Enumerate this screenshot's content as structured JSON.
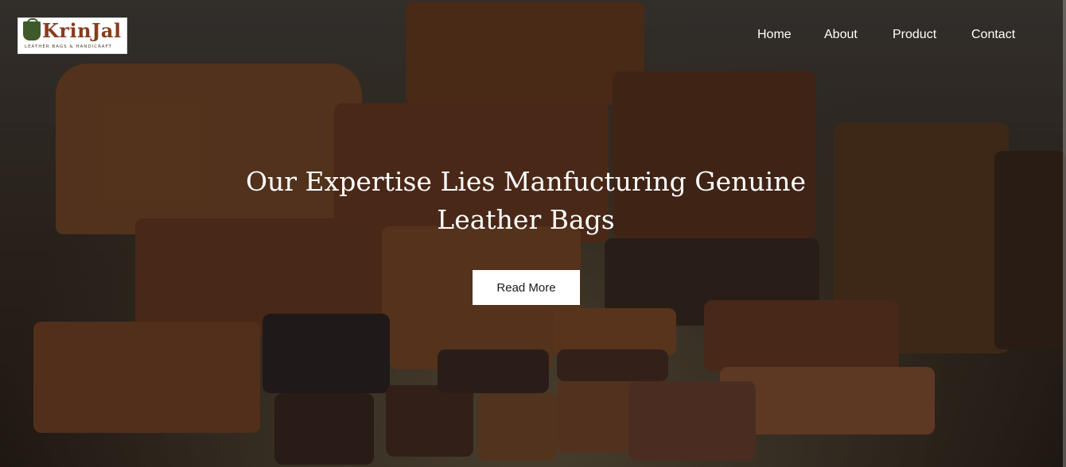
{
  "brand": {
    "name": "KrinJal",
    "tagline": "LEATHER BAGS & HANDICRAFT"
  },
  "nav": {
    "items": [
      {
        "label": "Home"
      },
      {
        "label": "About"
      },
      {
        "label": "Product"
      },
      {
        "label": "Contact"
      }
    ]
  },
  "hero": {
    "headline": "Our Expertise Lies Manfucturing Genuine Leather Bags",
    "cta_label": "Read More",
    "image_subject": "leather-bags-display",
    "colors": {
      "tan": "#8b5a33",
      "brown": "#6b3e22",
      "dark_brown": "#3d2517",
      "cta_bg": "#ffffff"
    }
  }
}
